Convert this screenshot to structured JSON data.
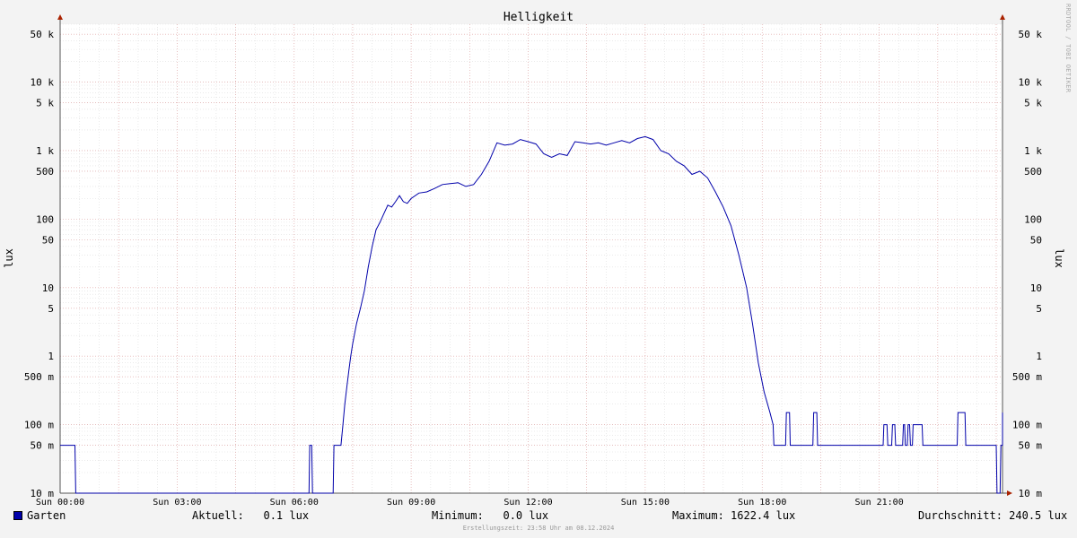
{
  "watermark": "RRDTOOL / TOBI OETIKER",
  "footer": "Erstellungszeit: 23:58 Uhr am 08.12.2024",
  "colors": {
    "line": "#0000aa",
    "background": "#f3f3f3",
    "plot_bg": "#ffffff",
    "major_grid": "#e0a0a0",
    "minor_grid": "#dddddd",
    "axis": "#555555",
    "arrow": "#aa2200"
  },
  "legend": {
    "series_name": "Garten",
    "current_label": "Aktuell:",
    "current_value": "0.1 lux",
    "min_label": "Minimum:",
    "min_value": "0.0 lux",
    "max_label": "Maximum:",
    "max_value": "1622.4 lux",
    "avg_label": "Durchschnitt:",
    "avg_value": "240.5 lux"
  },
  "chart_data": {
    "type": "line",
    "title": "Helligkeit",
    "ylabel": "lux",
    "y_scale": "log",
    "ylim": [
      0.01,
      70000
    ],
    "xlim": [
      0,
      24
    ],
    "x_ticks": [
      {
        "hour": 0,
        "label": "Sun 00:00"
      },
      {
        "hour": 3,
        "label": "Sun 03:00"
      },
      {
        "hour": 6,
        "label": "Sun 06:00"
      },
      {
        "hour": 9,
        "label": "Sun 09:00"
      },
      {
        "hour": 12,
        "label": "Sun 12:00"
      },
      {
        "hour": 15,
        "label": "Sun 15:00"
      },
      {
        "hour": 18,
        "label": "Sun 18:00"
      },
      {
        "hour": 21,
        "label": "Sun 21:00"
      }
    ],
    "y_ticks": [
      {
        "value": 0.01,
        "label": "10 m"
      },
      {
        "value": 0.05,
        "label": "50 m"
      },
      {
        "value": 0.1,
        "label": "100 m"
      },
      {
        "value": 0.5,
        "label": "500 m"
      },
      {
        "value": 1,
        "label": "1"
      },
      {
        "value": 5,
        "label": "5"
      },
      {
        "value": 10,
        "label": "10"
      },
      {
        "value": 50,
        "label": "50"
      },
      {
        "value": 100,
        "label": "100"
      },
      {
        "value": 500,
        "label": "500"
      },
      {
        "value": 1000,
        "label": "1 k"
      },
      {
        "value": 5000,
        "label": "5 k"
      },
      {
        "value": 10000,
        "label": "10 k"
      },
      {
        "value": 50000,
        "label": "50 k"
      }
    ],
    "grid": true,
    "series": [
      {
        "name": "Garten",
        "points": [
          [
            0,
            0.05
          ],
          [
            0.38,
            0.05
          ],
          [
            0.4,
            0.01
          ],
          [
            6.38,
            0.01
          ],
          [
            6.4,
            0.05
          ],
          [
            6.45,
            0.05
          ],
          [
            6.47,
            0.01
          ],
          [
            7.0,
            0.01
          ],
          [
            7.02,
            0.05
          ],
          [
            7.2,
            0.05
          ],
          [
            7.25,
            0.1
          ],
          [
            7.3,
            0.2
          ],
          [
            7.35,
            0.35
          ],
          [
            7.4,
            0.6
          ],
          [
            7.45,
            1.0
          ],
          [
            7.5,
            1.5
          ],
          [
            7.6,
            3
          ],
          [
            7.7,
            5
          ],
          [
            7.8,
            9
          ],
          [
            7.9,
            20
          ],
          [
            8.0,
            40
          ],
          [
            8.1,
            70
          ],
          [
            8.2,
            90
          ],
          [
            8.3,
            120
          ],
          [
            8.4,
            160
          ],
          [
            8.5,
            150
          ],
          [
            8.6,
            180
          ],
          [
            8.7,
            220
          ],
          [
            8.8,
            180
          ],
          [
            8.9,
            170
          ],
          [
            9.0,
            200
          ],
          [
            9.2,
            240
          ],
          [
            9.4,
            250
          ],
          [
            9.6,
            280
          ],
          [
            9.8,
            320
          ],
          [
            10.0,
            330
          ],
          [
            10.2,
            340
          ],
          [
            10.4,
            300
          ],
          [
            10.6,
            320
          ],
          [
            10.8,
            450
          ],
          [
            11.0,
            700
          ],
          [
            11.2,
            1300
          ],
          [
            11.4,
            1200
          ],
          [
            11.6,
            1250
          ],
          [
            11.8,
            1450
          ],
          [
            12.0,
            1350
          ],
          [
            12.2,
            1250
          ],
          [
            12.4,
            900
          ],
          [
            12.6,
            800
          ],
          [
            12.8,
            900
          ],
          [
            13.0,
            850
          ],
          [
            13.2,
            1350
          ],
          [
            13.4,
            1300
          ],
          [
            13.6,
            1250
          ],
          [
            13.8,
            1300
          ],
          [
            14.0,
            1200
          ],
          [
            14.2,
            1300
          ],
          [
            14.4,
            1400
          ],
          [
            14.6,
            1300
          ],
          [
            14.8,
            1500
          ],
          [
            15.0,
            1600
          ],
          [
            15.2,
            1450
          ],
          [
            15.4,
            1000
          ],
          [
            15.6,
            900
          ],
          [
            15.8,
            700
          ],
          [
            16.0,
            600
          ],
          [
            16.2,
            450
          ],
          [
            16.4,
            500
          ],
          [
            16.6,
            400
          ],
          [
            16.8,
            250
          ],
          [
            17.0,
            150
          ],
          [
            17.2,
            80
          ],
          [
            17.4,
            30
          ],
          [
            17.6,
            10
          ],
          [
            17.75,
            3
          ],
          [
            17.9,
            0.8
          ],
          [
            18.05,
            0.3
          ],
          [
            18.2,
            0.15
          ],
          [
            18.28,
            0.1
          ],
          [
            18.3,
            0.05
          ],
          [
            18.6,
            0.05
          ],
          [
            18.62,
            0.15
          ],
          [
            18.7,
            0.15
          ],
          [
            18.72,
            0.05
          ],
          [
            19.3,
            0.05
          ],
          [
            19.32,
            0.15
          ],
          [
            19.4,
            0.15
          ],
          [
            19.42,
            0.05
          ],
          [
            21.1,
            0.05
          ],
          [
            21.12,
            0.1
          ],
          [
            21.2,
            0.1
          ],
          [
            21.22,
            0.05
          ],
          [
            21.32,
            0.05
          ],
          [
            21.34,
            0.1
          ],
          [
            21.4,
            0.1
          ],
          [
            21.42,
            0.05
          ],
          [
            21.6,
            0.05
          ],
          [
            21.62,
            0.1
          ],
          [
            21.65,
            0.1
          ],
          [
            21.67,
            0.05
          ],
          [
            21.72,
            0.05
          ],
          [
            21.74,
            0.1
          ],
          [
            21.78,
            0.1
          ],
          [
            21.8,
            0.05
          ],
          [
            21.85,
            0.05
          ],
          [
            21.87,
            0.1
          ],
          [
            22.1,
            0.1
          ],
          [
            22.12,
            0.05
          ],
          [
            23.0,
            0.05
          ],
          [
            23.02,
            0.15
          ],
          [
            23.2,
            0.15
          ],
          [
            23.22,
            0.05
          ],
          [
            24.0,
            0.05
          ],
          [
            24.02,
            0.01
          ],
          [
            24.1,
            0.01
          ],
          [
            24.12,
            0.05
          ],
          [
            24.4,
            0.05
          ],
          [
            24.42,
            0.15
          ],
          [
            24.5,
            0.15
          ],
          [
            24.52,
            0.05
          ]
        ]
      }
    ]
  }
}
